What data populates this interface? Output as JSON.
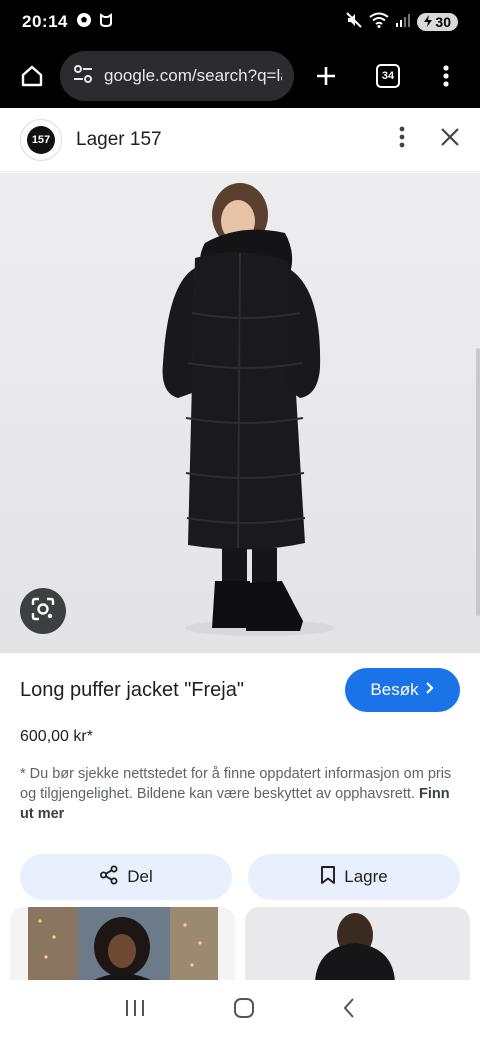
{
  "status_bar": {
    "time": "20:14",
    "battery": "30"
  },
  "browser": {
    "url": "google.com/search?q=lar",
    "tab_count": "34"
  },
  "sheet_header": {
    "site_logo_text": "157",
    "site_name": "Lager 157"
  },
  "product": {
    "title": "Long puffer jacket \"Freja\"",
    "visit_label": "Besøk",
    "price": "600,00 kr*",
    "disclaimer": "* Du bør sjekke nettstedet for å finne oppdatert informasjon om pris og tilgjengelighet. Bildene kan være beskyttet av opphavsrett.",
    "learn_more": "Finn ut mer"
  },
  "actions": {
    "share_label": "Del",
    "save_label": "Lagre"
  },
  "colors": {
    "accent": "#1a73e8",
    "action_bg": "#e8f0fe"
  }
}
